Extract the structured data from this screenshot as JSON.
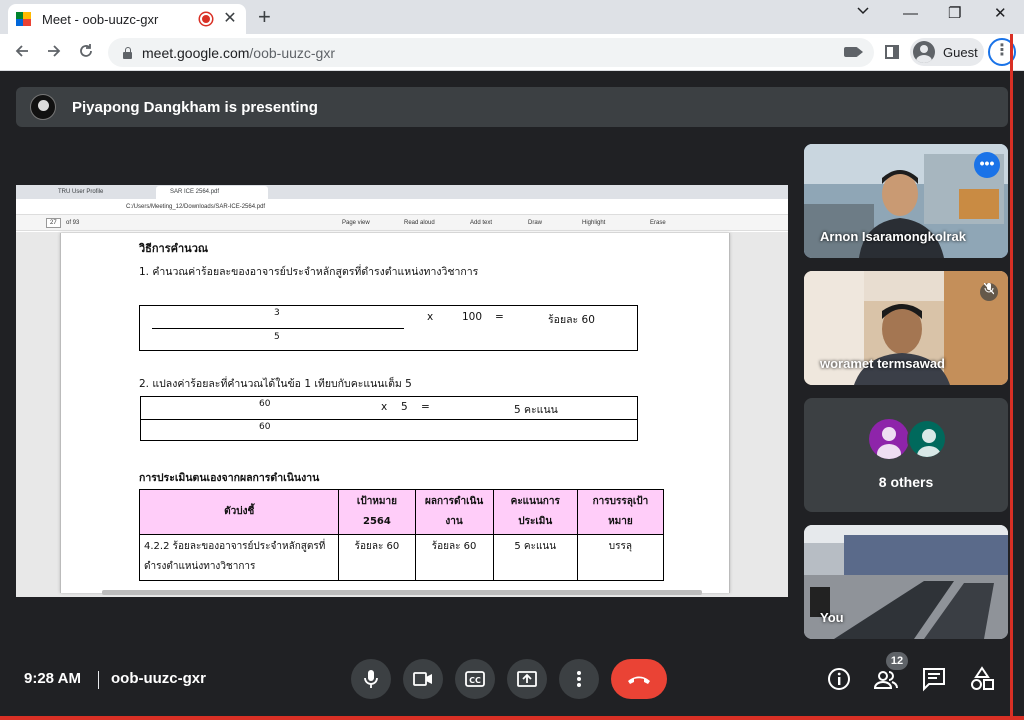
{
  "browser": {
    "tab_title": "Meet - oob-uuzc-gxr",
    "tab_close": "✕",
    "new_tab": "+",
    "url_host": "meet.google.com",
    "url_path": "/oob-uuzc-gxr",
    "profile_label": "Guest",
    "window_controls": {
      "minimize": "—",
      "restore": "❐",
      "close": "✕"
    }
  },
  "meet": {
    "presenter_banner": "Piyapong Dangkham is presenting",
    "time": "9:28 AM",
    "meeting_code": "oob-uuzc-gxr",
    "people_count": "12",
    "participants": [
      {
        "name": "Arnon Isaramongkolrak"
      },
      {
        "name": "woramet termsawad"
      }
    ],
    "others_label": "8 others",
    "self_label": "You"
  },
  "shared_screen": {
    "tabs": [
      "TRU User Profile",
      "SAR ICE 2564.pdf"
    ],
    "address": "C:/Users/Meeting_12/Downloads/SAR-ICE-2564.pdf",
    "pdf_toolbar": {
      "page": "27",
      "of_pages": "of 93",
      "page_view": "Page view",
      "read_aloud": "Read aloud",
      "add_text": "Add text",
      "draw": "Draw",
      "highlight": "Highlight",
      "erase": "Erase"
    },
    "doc": {
      "heading": "วิธีการคำนวณ",
      "step1": "1. คำนวณค่าร้อยละของอาจารย์ประจำหลักสูตรที่ดำรงตำแหน่งทางวิชาการ",
      "f1_num": "3",
      "f1_den": "5",
      "f1_x": "x",
      "f1_100": "100",
      "f1_eq": "=",
      "f1_result": "ร้อยละ 60",
      "step2": "2. แปลงค่าร้อยละที่คำนวณได้ในข้อ 1 เทียบกับคะแนนเต็ม 5",
      "f2_num": "60",
      "f2_den": "60",
      "f2_x": "x",
      "f2_5": "5",
      "f2_eq": "=",
      "f2_result": "5 คะแนน",
      "section": "การประเมินตนเองจากผลการดำเนินงาน",
      "table": {
        "headers": [
          "ตัวบ่งชี้",
          "เป้าหมาย 2564",
          "ผลการดำเนินงาน",
          "คะแนนการประเมิน",
          "การบรรลุเป้าหมาย"
        ],
        "row": [
          "4.2.2 ร้อยละของอาจารย์ประจำหลักสูตรที่ดำรงตำแหน่งทางวิชาการ",
          "ร้อยละ 60",
          "ร้อยละ 60",
          "5 คะแนน",
          "บรรลุ"
        ]
      }
    }
  },
  "colors": {
    "meet_bg": "#202124",
    "tile_bg": "#3c4043",
    "end_call": "#ea4335",
    "active_outline": "#8ab4f8",
    "table_header": "#ffcdf9"
  }
}
